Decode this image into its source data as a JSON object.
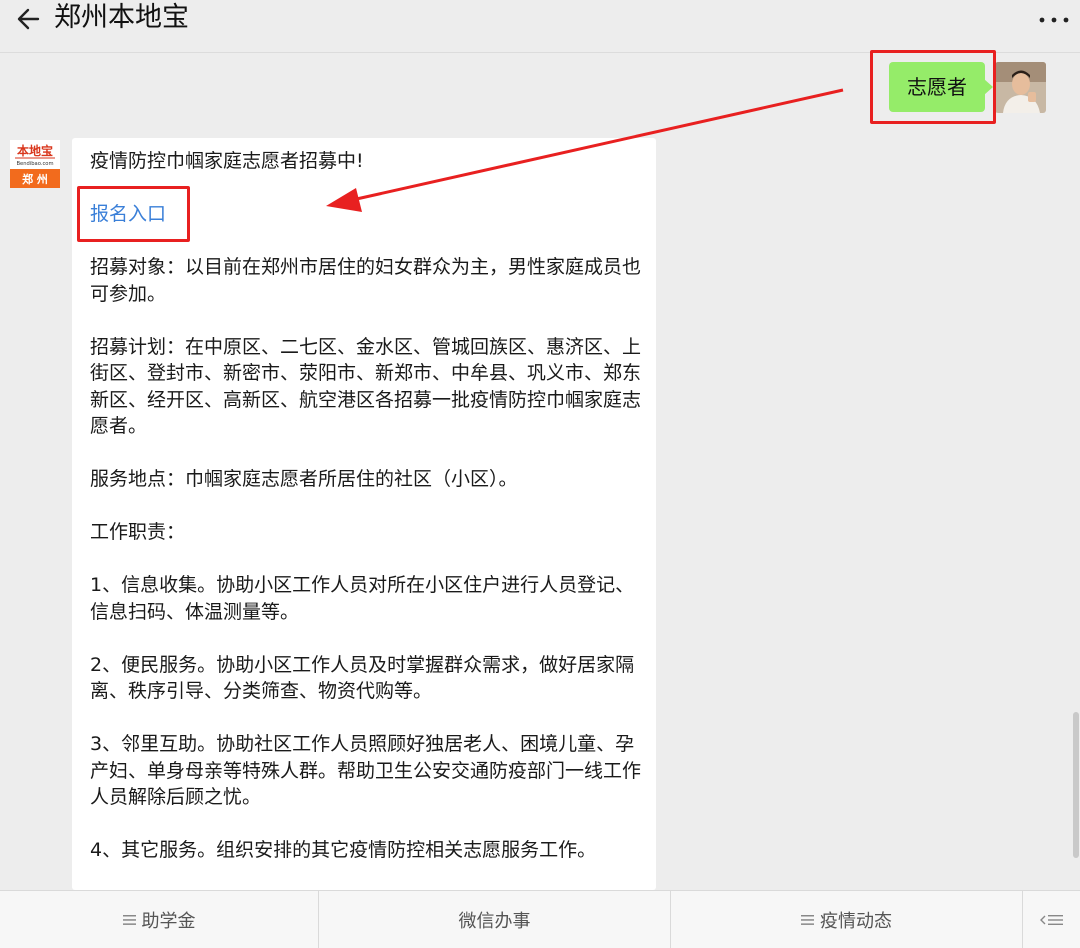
{
  "header": {
    "title": "郑州本地宝",
    "back_icon": "arrow-left-icon",
    "more_icon": "more-dots-icon"
  },
  "chat": {
    "user_message": "志愿者",
    "bot_avatar": {
      "brand_text": "本地宝",
      "domain_text": "Bendibao.com",
      "city_text": "郑 州"
    },
    "bot_message": {
      "headline": "疫情防控巾帼家庭志愿者招募中!",
      "link_text": "报名入口",
      "paragraphs": [
        "招募对象：以目前在郑州市居住的妇女群众为主，男性家庭成员也可参加。",
        "招募计划：在中原区、二七区、金水区、管城回族区、惠济区、上街区、登封市、新密市、荥阳市、新郑市、中牟县、巩义市、郑东新区、经开区、高新区、航空港区各招募一批疫情防控巾帼家庭志愿者。",
        "服务地点：巾帼家庭志愿者所居住的社区（小区）。",
        "工作职责：",
        " 1、信息收集。协助小区工作人员对所在小区住户进行人员登记、信息扫码、体温测量等。",
        " 2、便民服务。协助小区工作人员及时掌握群众需求，做好居家隔离、秩序引导、分类筛查、物资代购等。",
        " 3、邻里互助。协助社区工作人员照顾好独居老人、困境儿童、孕产妇、单身母亲等特殊人群。帮助卫生公安交通防疫部门一线工作人员解除后顾之忧。",
        " 4、其它服务。组织安排的其它疫情防控相关志愿服务工作。"
      ]
    }
  },
  "bottom_menu": {
    "items": [
      {
        "label": "助学金",
        "icon": "menu-lines-icon"
      },
      {
        "label": "微信办事"
      },
      {
        "label": "疫情动态",
        "icon": "menu-lines-icon"
      }
    ],
    "keyboard_icon": "keyboard-toggle-icon"
  },
  "colors": {
    "background": "#ededed",
    "user_bubble": "#95ec69",
    "link": "#3a7fd8",
    "annotation_red": "#e82020",
    "bot_avatar_orange": "#f26b1d"
  }
}
